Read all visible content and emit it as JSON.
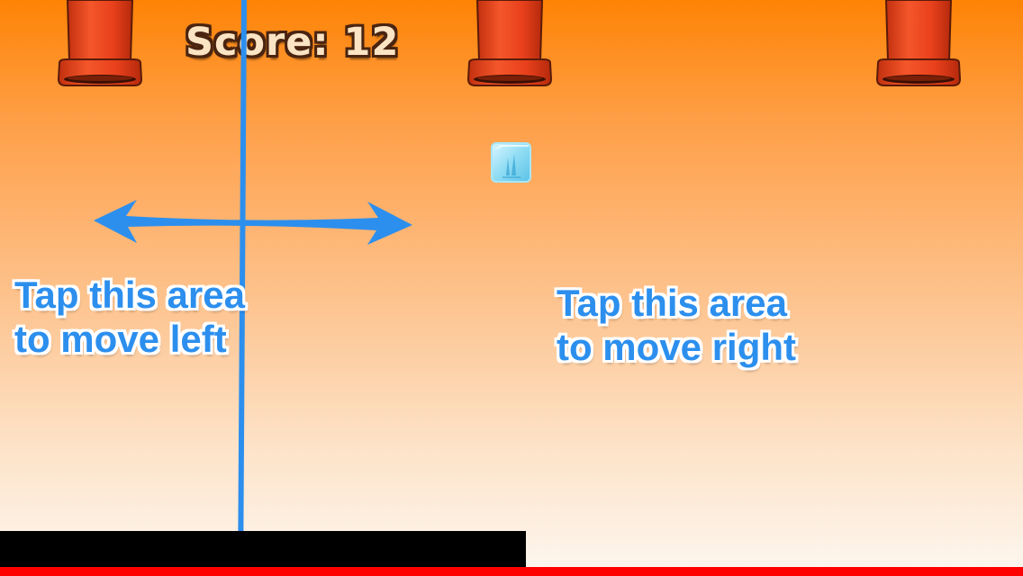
{
  "game": {
    "score_label": "Score: 12",
    "score_value": 12
  },
  "entities": {
    "buckets": [
      {
        "name": "red-bucket-left",
        "icon": "bucket-icon"
      },
      {
        "name": "red-bucket-center",
        "icon": "bucket-icon"
      },
      {
        "name": "red-bucket-right",
        "icon": "bucket-icon"
      }
    ],
    "player": {
      "icon": "ice-cube-icon"
    }
  },
  "tutorial": {
    "left_line1": "Tap this area",
    "left_line2": "to move left",
    "right_line1": "Tap this area",
    "right_line2": "to move right",
    "arrow_icon": "double-headed-arrow-icon"
  },
  "colors": {
    "sky_top": "#fe8305",
    "sky_bottom": "#fdf7f0",
    "hint_blue": "#2c8fee",
    "bucket_red": "#e8401c",
    "score_fill": "#fbe4c3",
    "score_outline": "#4a2410",
    "platform": "#000000",
    "floor": "#ff0000"
  }
}
